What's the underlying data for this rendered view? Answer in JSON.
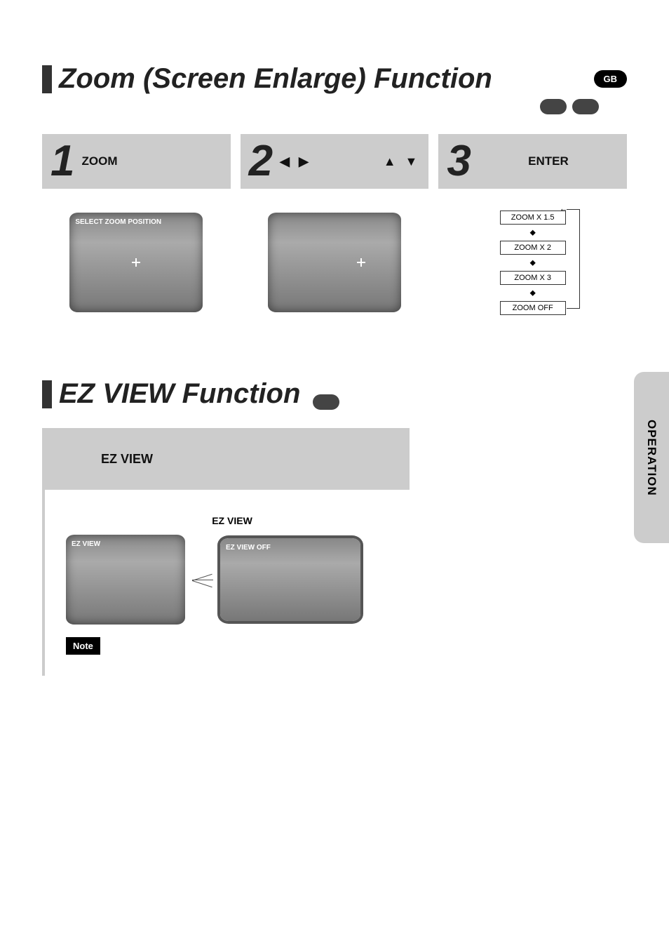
{
  "header": {
    "title1": "Zoom (Screen Enlarge) Function",
    "title2": "EZ VIEW Function",
    "gb": "GB"
  },
  "sideTab": "OPERATION",
  "steps": {
    "s1": {
      "num": "1",
      "label": "ZOOM",
      "screenLabel": "SELECT ZOOM POSITION"
    },
    "s2": {
      "num": "2",
      "arrowsLR": "◀ ▶",
      "arrowsUD": "▲ ▼"
    },
    "s3": {
      "num": "3",
      "label": "ENTER"
    }
  },
  "zoomLevels": [
    "ZOOM X 1.5",
    "ZOOM X 2",
    "ZOOM X 3",
    "ZOOM OFF"
  ],
  "ez": {
    "headerLabel": "EZ VIEW",
    "pressLabel": "EZ VIEW",
    "imgLabel1": "EZ VIEW",
    "imgLabel2": "EZ VIEW OFF",
    "note": "Note"
  }
}
